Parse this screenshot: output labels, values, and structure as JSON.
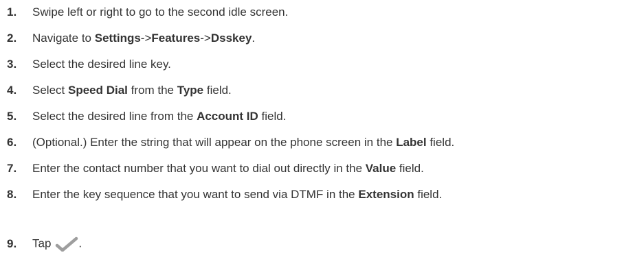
{
  "steps": [
    {
      "num": "1.",
      "parts": [
        "Swipe left or right to go to the second idle screen."
      ]
    },
    {
      "num": "2.",
      "parts": [
        "Navigate to ",
        "Settings",
        "->",
        "Features",
        "->",
        "Dsskey",
        "."
      ]
    },
    {
      "num": "3.",
      "parts": [
        "Select the desired line key."
      ]
    },
    {
      "num": "4.",
      "parts": [
        "Select ",
        "Speed Dial",
        " from the ",
        "Type",
        " field."
      ]
    },
    {
      "num": "5.",
      "parts": [
        "Select the desired line from the ",
        "Account ID",
        " field."
      ]
    },
    {
      "num": "6.",
      "parts": [
        "(Optional.) Enter the string that will appear on the phone screen in the ",
        "Label",
        " field."
      ]
    },
    {
      "num": "7.",
      "parts": [
        "Enter the contact number that you want to dial out directly in the ",
        "Value",
        " field."
      ]
    },
    {
      "num": "8.",
      "parts": [
        "Enter the key sequence that you want to send via DTMF in the ",
        "Extension",
        " field."
      ]
    },
    {
      "num": "9.",
      "parts": [
        "Tap",
        "."
      ]
    }
  ],
  "icons": {
    "check": "check-icon"
  },
  "colors": {
    "text": "#333333",
    "check": "#9e9e9e"
  }
}
